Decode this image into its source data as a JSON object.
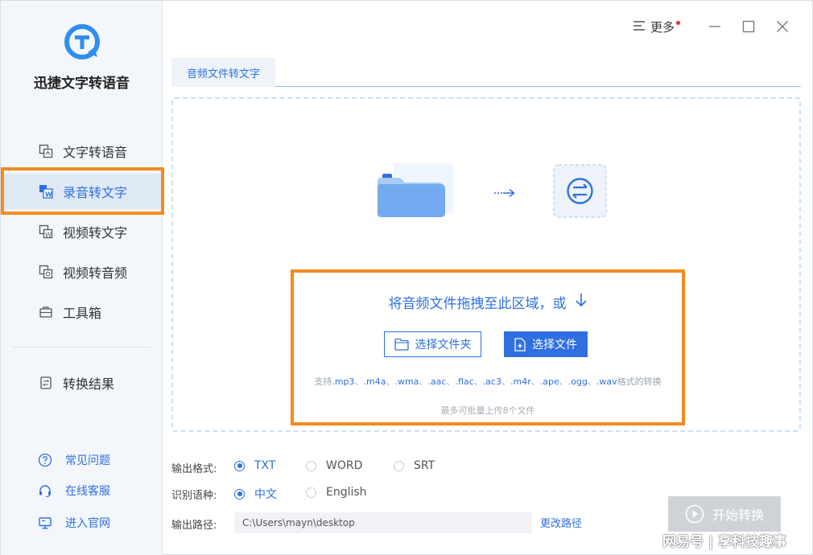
{
  "app": {
    "name": "迅捷文字转语音"
  },
  "sidebar": {
    "items": [
      {
        "label": "文字转语音",
        "icon": "text-to-speech-icon"
      },
      {
        "label": "录音转文字",
        "icon": "audio-to-text-icon",
        "active": true
      },
      {
        "label": "视频转文字",
        "icon": "video-to-text-icon"
      },
      {
        "label": "视频转音频",
        "icon": "video-to-audio-icon"
      },
      {
        "label": "工具箱",
        "icon": "toolbox-icon"
      },
      {
        "label": "转换结果",
        "icon": "results-icon"
      }
    ],
    "help": [
      {
        "label": "常见问题",
        "icon": "question-icon"
      },
      {
        "label": "在线客服",
        "icon": "headset-icon"
      },
      {
        "label": "进入官网",
        "icon": "monitor-icon"
      }
    ]
  },
  "titlebar": {
    "more_label": "更多"
  },
  "tabs": [
    {
      "label": "音频文件转文字"
    }
  ],
  "dropzone": {
    "prompt": "将音频文件拖拽至此区域，或",
    "select_folder": "选择文件夹",
    "select_file": "选择文件",
    "support_prefix": "支持",
    "formats": [
      ".mp3",
      ".m4a",
      ".wma",
      ".aac",
      ".flac",
      ".ac3",
      ".m4r",
      ".ape",
      ".ogg",
      ".wav"
    ],
    "support_suffix": "格式的转换",
    "limit": "最多可批量上传8个文件"
  },
  "output": {
    "format_label": "输出格式:",
    "formats": [
      "TXT",
      "WORD",
      "SRT"
    ],
    "format_selected": "TXT",
    "language_label": "识别语种:",
    "languages": [
      "中文",
      "English"
    ],
    "language_selected": "中文",
    "path_label": "输出路径:",
    "path_value": "C:\\Users\\mayn\\desktop",
    "change_path": "更改路径",
    "start_label": "开始转换"
  },
  "watermark": "网易号 | 享科技趣事",
  "colors": {
    "accent": "#2f6fe0",
    "highlight": "#f58a1f",
    "dot": "#e42d2d"
  }
}
